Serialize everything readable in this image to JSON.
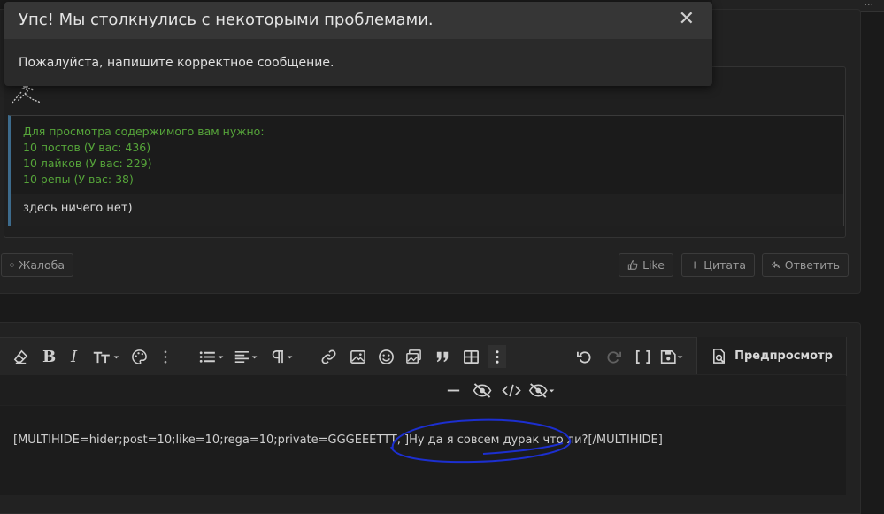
{
  "modal": {
    "title": "Упс! Мы столкнулись с некоторыми проблемами.",
    "close_glyph": "✕",
    "message": "Пожалуйста, напишите корректное сообщение."
  },
  "top_strip_text": "...",
  "hide_block": {
    "requirements_title": "Для просмотра содержимого вам нужно:",
    "requirements": [
      "10 постов (У вас: 436)",
      "10 лайков (У вас: 229)",
      "10 репы (У вас: 38)"
    ],
    "content": "здесь ничего нет)"
  },
  "post_actions": {
    "report": "Жалоба",
    "like": "Like",
    "quote": "Цитата",
    "reply": "Ответить"
  },
  "editor": {
    "preview_label": "Предпросмотр",
    "content": "[MULTIHIDE=hider;post=10;like=10;rega=10;private=GGGEEETTT, ]Ну да я совсем дурак что ли?[/MULTIHIDE]"
  },
  "colors": {
    "accent_green": "#56a53a",
    "quote_border": "#3d6b8c",
    "annotation_blue": "#1c2fd0"
  }
}
